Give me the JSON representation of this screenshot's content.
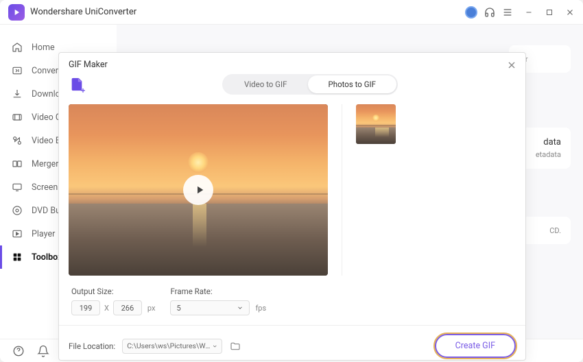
{
  "app": {
    "title": "Wondershare UniConverter"
  },
  "sidebar": {
    "items": [
      {
        "label": "Home",
        "icon": "home-icon"
      },
      {
        "label": "Converter",
        "icon": "converter-icon"
      },
      {
        "label": "Downloader",
        "icon": "download-icon"
      },
      {
        "label": "Video Compressor",
        "icon": "video-compressor-icon"
      },
      {
        "label": "Video Editor",
        "icon": "video-editor-icon"
      },
      {
        "label": "Merger",
        "icon": "merger-icon"
      },
      {
        "label": "Screen Recorder",
        "icon": "screen-recorder-icon"
      },
      {
        "label": "DVD Burner",
        "icon": "dvd-burner-icon"
      },
      {
        "label": "Player",
        "icon": "player-icon"
      },
      {
        "label": "Toolbox",
        "icon": "toolbox-icon"
      }
    ]
  },
  "background": {
    "card1_title": "tor",
    "card2_title": "data",
    "card2_sub": "etadata",
    "card3_text": "CD."
  },
  "modal": {
    "title": "GIF Maker",
    "tabs": {
      "video": "Video to GIF",
      "photos": "Photos to GIF"
    },
    "output_size_label": "Output Size:",
    "output_width": "199",
    "output_height": "266",
    "size_separator": "X",
    "size_unit": "px",
    "frame_rate_label": "Frame Rate:",
    "frame_rate_value": "5",
    "frame_rate_unit": "fps",
    "file_location_label": "File Location:",
    "file_location_path": "C:\\Users\\ws\\Pictures\\Wonders",
    "create_button": "Create GIF"
  }
}
